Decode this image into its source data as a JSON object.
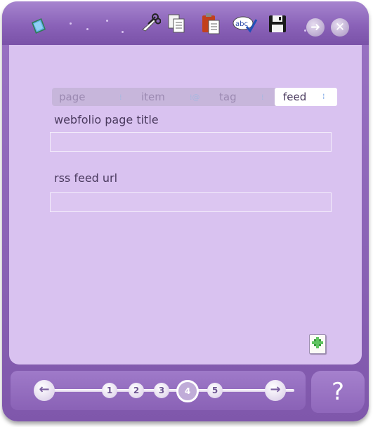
{
  "toolbar": {
    "items": [
      {
        "icon": "book-icon"
      },
      {
        "icon": "scissors-icon"
      },
      {
        "icon": "copy-icon"
      },
      {
        "icon": "paste-icon"
      },
      {
        "icon": "spellcheck-icon",
        "text": "abc"
      },
      {
        "icon": "save-icon"
      },
      {
        "icon": "forward-icon"
      },
      {
        "icon": "close-icon"
      }
    ]
  },
  "tabs": [
    {
      "label": "page",
      "active": false
    },
    {
      "label": "item",
      "active": false
    },
    {
      "label": "tag",
      "active": false
    },
    {
      "label": "feed",
      "active": true
    }
  ],
  "form": {
    "title_label": "webfolio page title",
    "title_value": "",
    "rss_label": "rss feed url",
    "rss_value": ""
  },
  "footer": {
    "prev_icon": "left-arrow-icon",
    "next_icon": "right-arrow-icon",
    "steps": [
      "1",
      "2",
      "3",
      "4",
      "5"
    ],
    "current_step": "4",
    "help_label": "?"
  },
  "colors": {
    "frame": "#8a62b8",
    "content": "#d9c2f0",
    "active_tab": "#ffffff",
    "text": "#4a3a5e"
  }
}
